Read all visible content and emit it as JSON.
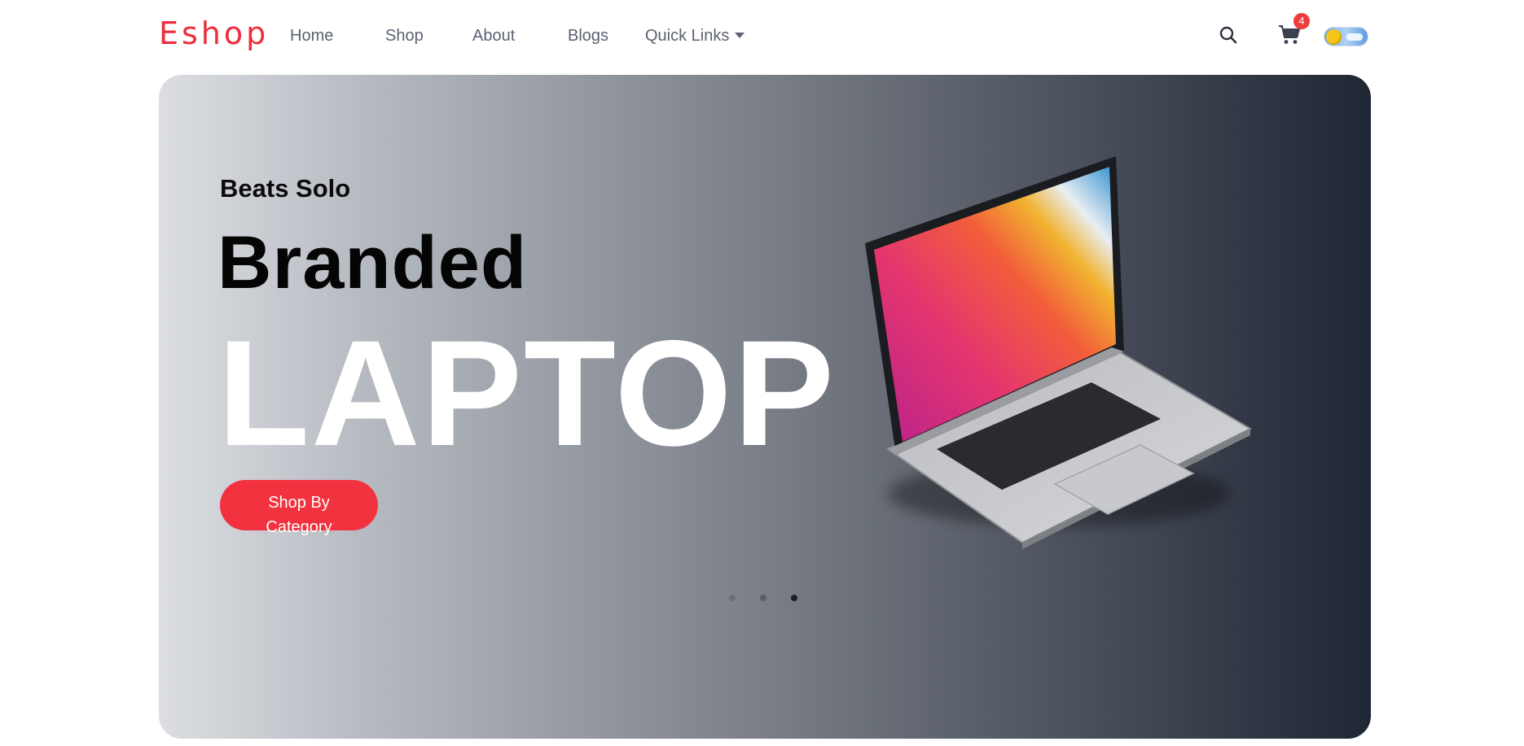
{
  "brand": {
    "logo_text": "Eshop",
    "accent": "#ef2d3c"
  },
  "nav": {
    "links": [
      {
        "label": "Home"
      },
      {
        "label": "Shop"
      },
      {
        "label": "About"
      },
      {
        "label": "Blogs"
      },
      {
        "label": "Quick Links"
      }
    ]
  },
  "header_actions": {
    "search_icon": "search-icon",
    "cart_icon": "cart-icon",
    "cart_count": "4",
    "theme_toggle": "light-mode-toggle"
  },
  "hero": {
    "subtitle": "Beats Solo",
    "title": "Branded",
    "big_title": "LAPTOP",
    "cta_label": "Shop By Category",
    "cta_color": "#f2323f",
    "slides_total": 3,
    "active_slide": 3
  }
}
